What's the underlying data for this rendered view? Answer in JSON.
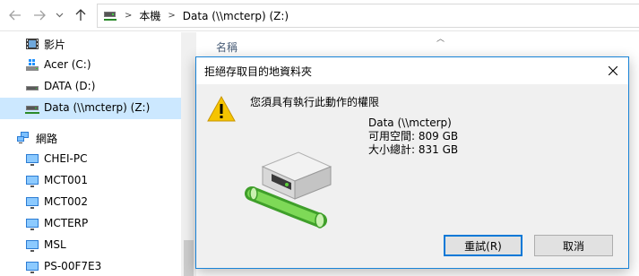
{
  "addressbar": {
    "crumbs": [
      "本機",
      "Data (\\\\mcterp) (Z:)"
    ]
  },
  "navpane": {
    "items": [
      {
        "label": "影片",
        "icon": "film-icon"
      },
      {
        "label": "Acer (C:)",
        "icon": "windows-drive-icon"
      },
      {
        "label": "DATA (D:)",
        "icon": "drive-icon"
      },
      {
        "label": "Data (\\\\mcterp) (Z:)",
        "icon": "network-drive-icon",
        "selected": true
      },
      {
        "label": "網路",
        "icon": "network-icon"
      },
      {
        "label": "CHEI-PC",
        "icon": "computer-icon"
      },
      {
        "label": "MCT001",
        "icon": "computer-icon"
      },
      {
        "label": "MCT002",
        "icon": "computer-icon"
      },
      {
        "label": "MCTERP",
        "icon": "computer-icon"
      },
      {
        "label": "MSL",
        "icon": "computer-icon"
      },
      {
        "label": "PS-00F7E3",
        "icon": "computer-icon"
      }
    ]
  },
  "content": {
    "column_name": "名稱"
  },
  "dialog": {
    "title": "拒絕存取目的地資料夾",
    "message": "您須具有執行此動作的權限",
    "drive_name": "Data (\\\\mcterp)",
    "free_space": "可用空間: 809 GB",
    "total_size": "大小總計: 831 GB",
    "retry_label": "重試(R)",
    "cancel_label": "取消",
    "colors": {
      "border": "#1883d7",
      "warning": "#f5c400",
      "drive_green": "#6cc24a"
    }
  }
}
